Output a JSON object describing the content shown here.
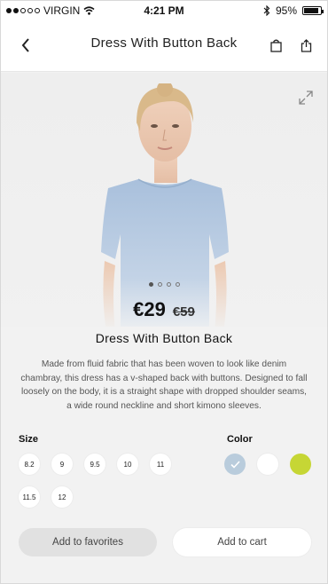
{
  "status_bar": {
    "carrier": "VIRGIN",
    "time": "4:21 PM",
    "battery": "95%"
  },
  "nav": {
    "title": "Dress With Button Back"
  },
  "product": {
    "price": "€29",
    "old_price": "€59",
    "name": "Dress With Button Back",
    "description": "Made from fluid fabric that has been woven to look like denim chambray, this dress has a v-shaped back with buttons. Designed to fall loosely on the body, it is a straight shape with dropped shoulder seams, a wide round neckline and short kimono sleeves."
  },
  "sizes": {
    "label": "Size",
    "options": [
      "8.2",
      "9",
      "9.5",
      "10",
      "11",
      "11.5",
      "12"
    ]
  },
  "colors": {
    "label": "Color",
    "options": [
      {
        "name": "light-blue",
        "hex": "#b9ccdc",
        "selected": true
      },
      {
        "name": "white",
        "hex": "#ffffff",
        "selected": false
      },
      {
        "name": "lime",
        "hex": "#c6d635",
        "selected": false
      }
    ]
  },
  "actions": {
    "favorites": "Add to favorites",
    "cart": "Add to cart"
  },
  "carousel": {
    "count": 4,
    "active": 0
  }
}
